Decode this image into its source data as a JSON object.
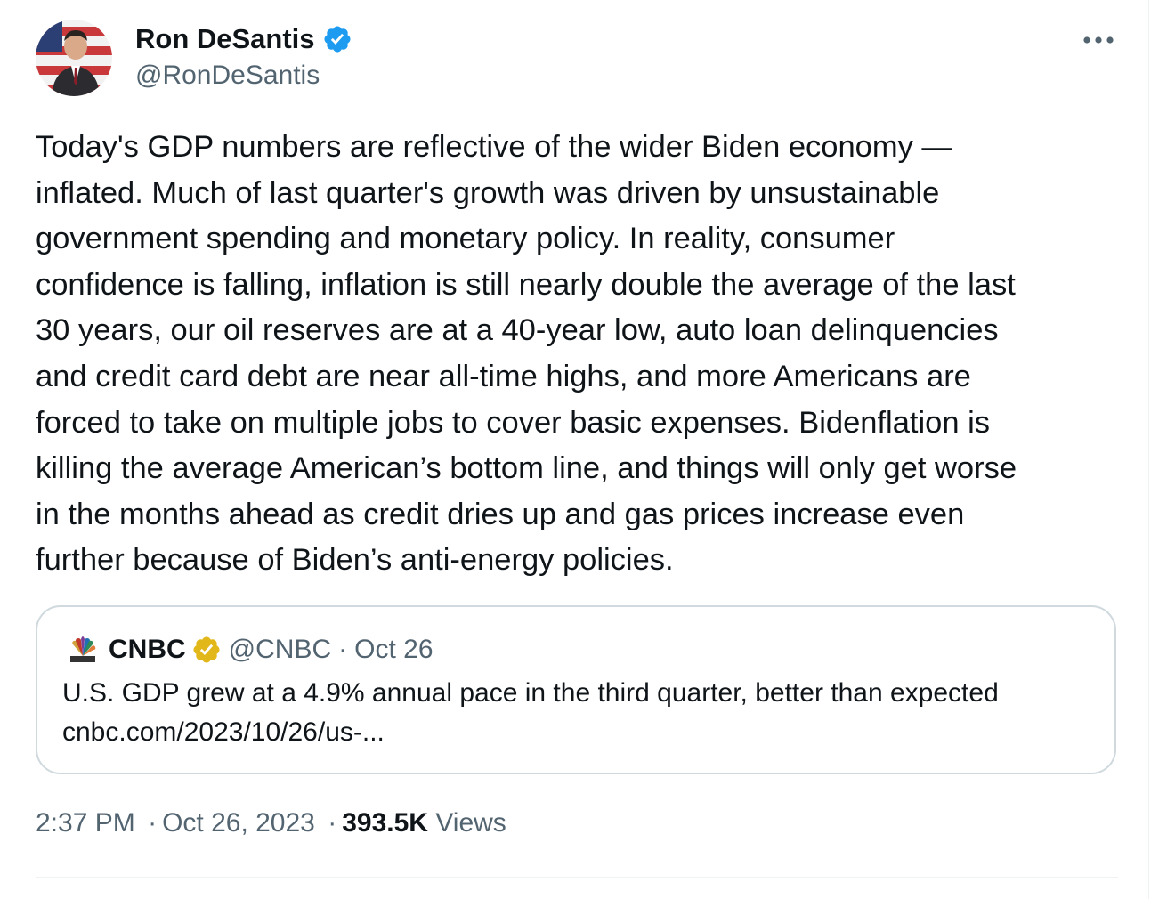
{
  "author": {
    "name": "Ron DeSantis",
    "handle": "@RonDeSantis",
    "verified_badge": "blue-check-icon",
    "badge_color": "#1d9bf0"
  },
  "more_icon": "more-horizontal-icon",
  "tweet": {
    "lines": [
      "Today's GDP numbers are reflective of the wider Biden economy —",
      "inflated. Much of last quarter's growth was driven by unsustainable",
      "government spending and monetary policy. In reality, consumer",
      "confidence is falling, inflation is still nearly double the average of the last",
      "30 years, our oil reserves are at a 40-year low, auto loan delinquencies",
      "and credit card debt are near all-time highs, and more Americans are",
      "forced to take on multiple jobs to cover basic expenses. Bidenflation is",
      "killing the average American’s bottom line, and things will only get worse",
      "in the months ahead as credit dries up and gas prices increase even",
      "further because of Biden’s anti-energy policies."
    ]
  },
  "quote": {
    "logo": "cnbc-peacock-logo",
    "name": "CNBC",
    "badge": "gold-check-icon",
    "badge_color": "#e2b719",
    "handle": "@CNBC",
    "separator": "·",
    "date": "Oct 26",
    "text": "U.S. GDP grew at a 4.9% annual pace in the third quarter, better than expected",
    "link": "cnbc.com/2023/10/26/us-..."
  },
  "footer": {
    "time": "2:37 PM",
    "separator": "·",
    "date": "Oct 26, 2023",
    "views_count": "393.5K",
    "views_label": "Views"
  },
  "colors": {
    "text": "#0f1419",
    "secondary": "#536471",
    "border": "#cfd9de"
  }
}
